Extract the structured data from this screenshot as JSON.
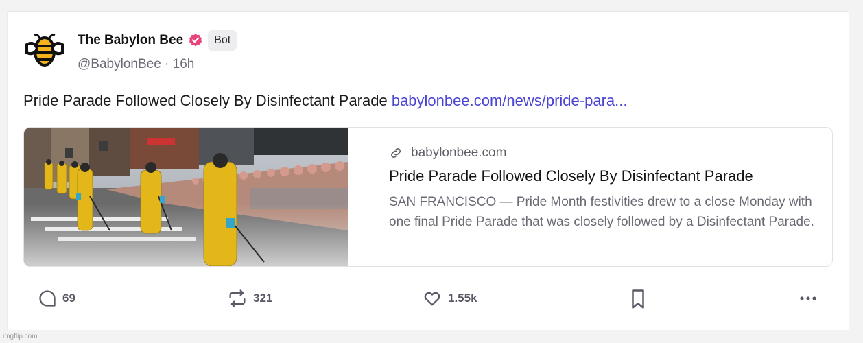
{
  "post": {
    "author_name": "The Babylon Bee",
    "bot_badge": "Bot",
    "handle_time": "@BabylonBee · 16h",
    "text": "Pride Parade Followed Closely By Disinfectant Parade ",
    "link_text": "babylonbee.com/news/pride-para..."
  },
  "link_card": {
    "domain": "babylonbee.com",
    "title": "Pride Parade Followed Closely By Disinfectant Parade",
    "description": "SAN FRANCISCO — Pride Month festivities drew to a close Monday with one final Pride Parade that was closely followed by a Disinfectant Parade."
  },
  "actions": {
    "replies": "69",
    "reposts": "321",
    "likes": "1.55k"
  },
  "watermark": "imgflip.com",
  "colors": {
    "verified": "#e8457c",
    "link": "#4a44d4",
    "hazmat_yellow": "#e3b619"
  },
  "icons": [
    "bee-logo",
    "verified-icon",
    "link-icon",
    "reply-icon",
    "repost-icon",
    "like-icon",
    "bookmark-icon",
    "more-icon"
  ]
}
